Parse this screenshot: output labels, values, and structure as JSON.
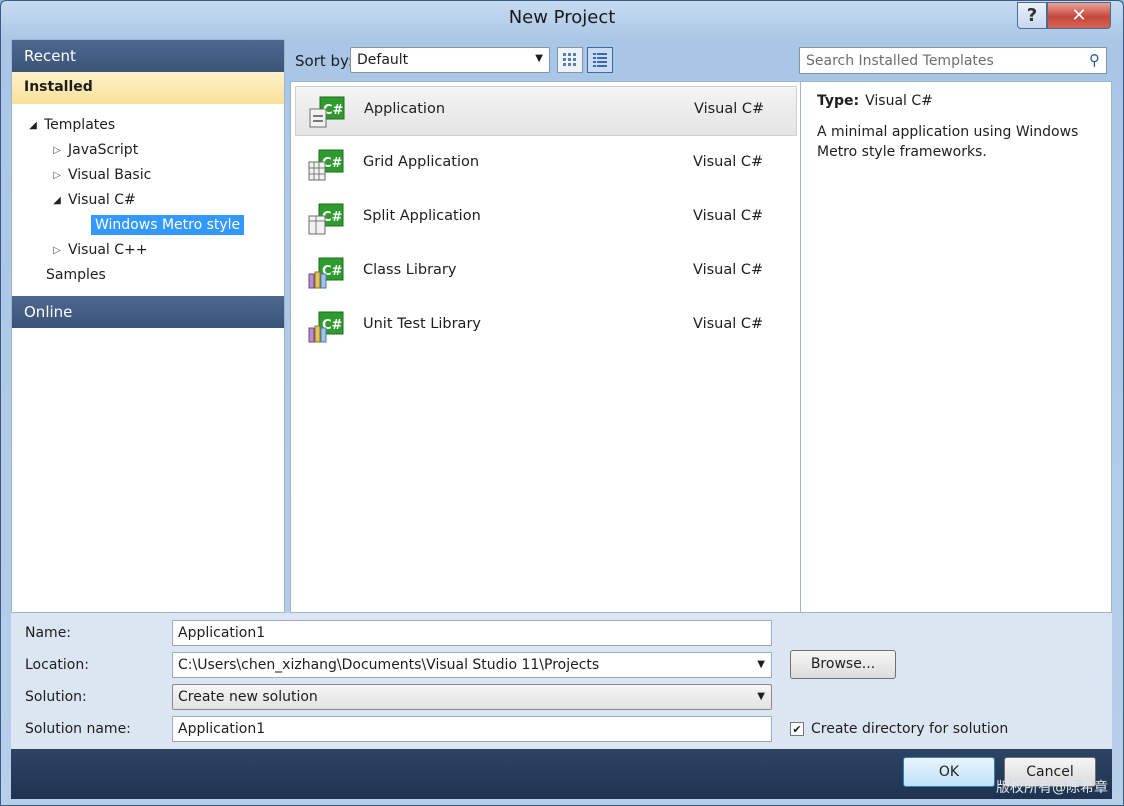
{
  "window": {
    "title": "New Project",
    "help_label": "?",
    "close_label": "✕"
  },
  "left_pane": {
    "recent": "Recent",
    "installed": "Installed",
    "tree": [
      {
        "label": "Templates",
        "level": 0,
        "state": "expanded"
      },
      {
        "label": "JavaScript",
        "level": 1,
        "state": "collapsed"
      },
      {
        "label": "Visual Basic",
        "level": 1,
        "state": "collapsed"
      },
      {
        "label": "Visual C#",
        "level": 1,
        "state": "expanded"
      },
      {
        "label": "Windows Metro style",
        "level": 2,
        "state": "selected"
      },
      {
        "label": "Visual C++",
        "level": 1,
        "state": "collapsed"
      },
      {
        "label": "Samples",
        "level": 0,
        "state": "leaf"
      }
    ],
    "online": "Online"
  },
  "toolbar": {
    "sort_label": "Sort by:",
    "sort_value": "Default",
    "search_placeholder": "Search Installed Templates"
  },
  "templates": [
    {
      "name": "Application",
      "language": "Visual C#",
      "selected": true
    },
    {
      "name": "Grid Application",
      "language": "Visual C#",
      "selected": false
    },
    {
      "name": "Split Application",
      "language": "Visual C#",
      "selected": false
    },
    {
      "name": "Class Library",
      "language": "Visual C#",
      "selected": false
    },
    {
      "name": "Unit Test Library",
      "language": "Visual C#",
      "selected": false
    }
  ],
  "details": {
    "type_label": "Type:",
    "type_value": "Visual C#",
    "description": "A minimal application using Windows Metro style frameworks."
  },
  "form": {
    "name_label": "Name:",
    "name_value": "Application1",
    "location_label": "Location:",
    "location_value": "C:\\Users\\chen_xizhang\\Documents\\Visual Studio 11\\Projects",
    "solution_label": "Solution:",
    "solution_value": "Create new solution",
    "solution_name_label": "Solution name:",
    "solution_name_value": "Application1",
    "browse_label": "Browse...",
    "create_dir_label": "Create directory for solution",
    "create_dir_checked": true
  },
  "buttons": {
    "ok": "OK",
    "cancel": "Cancel"
  },
  "watermark": "版权所有@陈希章",
  "colors": {
    "selection": "#3399ff",
    "header": "#3a5378",
    "installed_bg": "#f9e19a",
    "csharp_green": "#2e9b2e"
  }
}
